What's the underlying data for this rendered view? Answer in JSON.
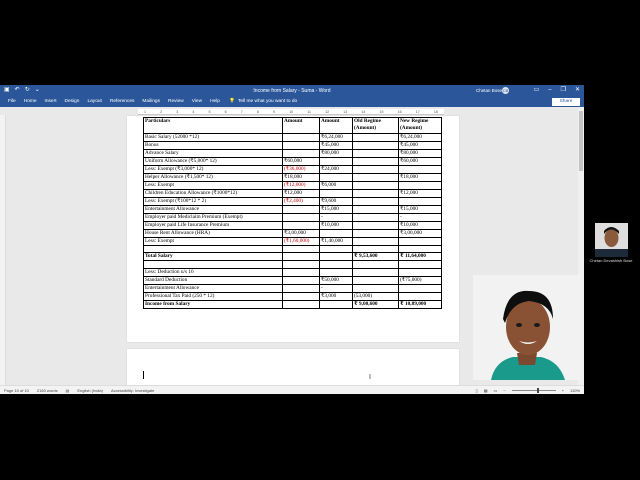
{
  "window": {
    "title": "Income from Salary - Suma - Word",
    "user": "Chetan Bose",
    "user_initials": "CB"
  },
  "ribbon": {
    "tabs": [
      "File",
      "Home",
      "Insert",
      "Design",
      "Layout",
      "References",
      "Mailings",
      "Review",
      "View",
      "Help"
    ],
    "tell_me": "Tell me what you want to do",
    "share": "Share"
  },
  "ruler": {
    "numbers": [
      "1",
      "2",
      "3",
      "4",
      "5",
      "6",
      "7",
      "8",
      "9",
      "10",
      "11",
      "12",
      "13",
      "14",
      "15",
      "16",
      "17",
      "18"
    ]
  },
  "table": {
    "headers": [
      "Particulars",
      "Amount",
      "Amount",
      "Old Regime (Amount)",
      "New Regime (Amount)"
    ],
    "rows": [
      {
        "c": [
          "Basic Salary (52000 *12)",
          "",
          "₹6,24,000",
          "",
          "₹6,24,000"
        ]
      },
      {
        "c": [
          "Bonus",
          "",
          "₹45,000",
          "",
          "₹45,000"
        ]
      },
      {
        "c": [
          "Advance Salary",
          "",
          "₹80,000",
          "",
          "₹80,000"
        ]
      },
      {
        "c": [
          "Uniform Allowance (₹5,000* 12)",
          "₹60,000",
          "",
          "",
          "₹60,000"
        ]
      },
      {
        "c": [
          "Less: Exempt (₹3,000* 12)",
          "(₹36,000)",
          "₹24,000",
          "",
          ""
        ],
        "red": [
          1
        ]
      },
      {
        "c": [
          "Helper Allowance (₹1,500* 12)",
          "₹18,000",
          "",
          "",
          "₹18,000"
        ]
      },
      {
        "c": [
          "Less: Exempt",
          "(₹12,000)",
          "₹6,000",
          "",
          ""
        ],
        "red": [
          1
        ]
      },
      {
        "c": [
          "Children Education Allowance (₹1000*12)",
          "₹12,000",
          "",
          "",
          "₹12,000"
        ]
      },
      {
        "c": [
          "Less: Exempt (₹100*12 * 2)",
          "(₹2,400)",
          "₹9,600",
          "",
          ""
        ],
        "red": [
          1
        ]
      },
      {
        "c": [
          "Entertainment Allowance",
          "",
          "₹15,000",
          "",
          "₹15,000"
        ]
      },
      {
        "c": [
          "Employer paid Mediclaim Premium (Exempt)",
          "",
          "-",
          "",
          "-"
        ]
      },
      {
        "c": [
          "Employer paid Life Insurance Premium",
          "",
          "₹10,000",
          "",
          "₹10,000"
        ]
      },
      {
        "c": [
          "House Rent Allowance (HRA)",
          "₹3,00,000",
          "",
          "",
          "₹3,00,000"
        ]
      },
      {
        "c": [
          "Less: Exempt",
          "(₹1,60,000)",
          "₹1,40,000",
          "",
          ""
        ],
        "red": [
          1
        ]
      },
      {
        "c": [
          "",
          "",
          "",
          "",
          ""
        ]
      },
      {
        "c": [
          "Total Salary",
          "",
          "",
          "₹ 9,53,600",
          "₹ 11,64,000"
        ],
        "bold": true
      },
      {
        "c": [
          "",
          "",
          "",
          "",
          ""
        ]
      },
      {
        "c": [
          "Less: Deduction u/s 16",
          "",
          "",
          "",
          ""
        ]
      },
      {
        "c": [
          "Standard Deduction",
          "",
          "₹50,000",
          "",
          "(₹75,000)"
        ]
      },
      {
        "c": [
          "Entertainment Allowance",
          "",
          "-",
          "",
          ""
        ]
      },
      {
        "c": [
          "Professional Tax Paid (250 * 12)",
          "",
          "₹3,000",
          "(53,000)",
          ""
        ]
      },
      {
        "c": [
          "Income from Salary",
          "",
          "",
          "₹ 9,00,600",
          "₹ 10,89,000"
        ],
        "bold": true
      }
    ]
  },
  "status": {
    "page": "Page 10 of 10",
    "words": "2160 words",
    "language": "English (India)",
    "accessibility": "Accessibility: Investigate",
    "zoom": "110%"
  },
  "webcam": {
    "small_label": "Chetan Devashish Bose"
  },
  "colors": {
    "ribbon": "#2b579a",
    "exempt_red": "#c00000"
  }
}
